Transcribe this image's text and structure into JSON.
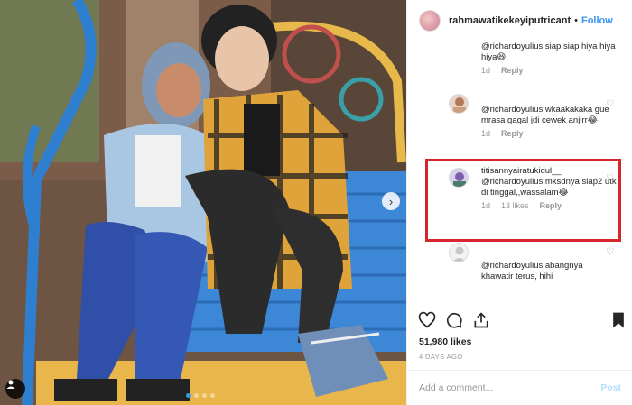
{
  "header": {
    "username": "rahmawatikekeyiputricant",
    "separator": "•",
    "follow_label": "Follow"
  },
  "comments": [
    {
      "text": "@richardoyulius siap siap hiya hiya hiya😆",
      "time": "1d",
      "likes": "",
      "reply": "Reply"
    },
    {
      "text": "@richardoyulius wkaakakaka gue mrasa gagal jdi cewek anjirr😂",
      "time": "1d",
      "likes": "",
      "reply": "Reply"
    },
    {
      "username": "titisannyairatukidul__",
      "text": "@richardoyulius mksdnya siap2 utk di tinggal,,wassalam😂",
      "time": "1d",
      "likes": "13 likes",
      "reply": "Reply"
    },
    {
      "text": "@richardoyulius abangnya khawatir terus, hihi",
      "time": "",
      "likes": "",
      "reply": ""
    }
  ],
  "post": {
    "likes": "51,980 likes",
    "timestamp": "4 DAYS AGO"
  },
  "add_comment": {
    "placeholder": "Add a comment...",
    "post_label": "Post"
  },
  "icons": {
    "heart": "heart-icon",
    "comment": "comment-icon",
    "share": "share-icon",
    "save": "bookmark-icon",
    "next": "chevron-right-icon",
    "tag": "user-tag-icon"
  },
  "colors": {
    "accent": "#3897f0",
    "highlight": "#d4262c"
  },
  "carousel": {
    "count": 4,
    "active": 1
  }
}
